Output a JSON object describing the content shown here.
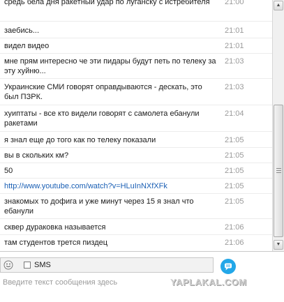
{
  "chat": {
    "messages": [
      {
        "text": "средь бела дня ракетный удар по луганску с истребителя",
        "time": "21:00"
      },
      {
        "text": "заебись...",
        "time": "21:01"
      },
      {
        "text": "видел видео",
        "time": "21:01"
      },
      {
        "text": "мне прям интересно че эти пидары будут петь по телеку за эту хуйню...",
        "time": "21:03"
      },
      {
        "text": "Украинские СМИ говорят оправдываются - дескать, это был ПЗРК.",
        "time": "21:03"
      },
      {
        "text": "хуиптаты - все кто видели говорят с самолета ебанули ракетами",
        "time": "21:04"
      },
      {
        "text": "я знал еще до того как по телеку показали",
        "time": "21:05"
      },
      {
        "text": "вы в скольких км?",
        "time": "21:05"
      },
      {
        "text": "50",
        "time": "21:05"
      },
      {
        "text": "http://www.youtube.com/watch?v=HLuInNXfXFk",
        "time": "21:05",
        "link": true
      },
      {
        "text": "знакомых то дофига и уже минут через 15 я знал что ебанули",
        "time": "21:05"
      },
      {
        "text": "сквер дураковка называется",
        "time": "21:06"
      },
      {
        "text": "там студентов трется пиздец",
        "time": "21:06"
      }
    ]
  },
  "input": {
    "sms_label": "SMS",
    "placeholder": "Введите текст сообщения здесь"
  },
  "watermark": "YAPLAKAL.COM",
  "colors": {
    "link": "#1a5fb4",
    "time": "#9a9a9a",
    "send": "#22a7e8"
  }
}
